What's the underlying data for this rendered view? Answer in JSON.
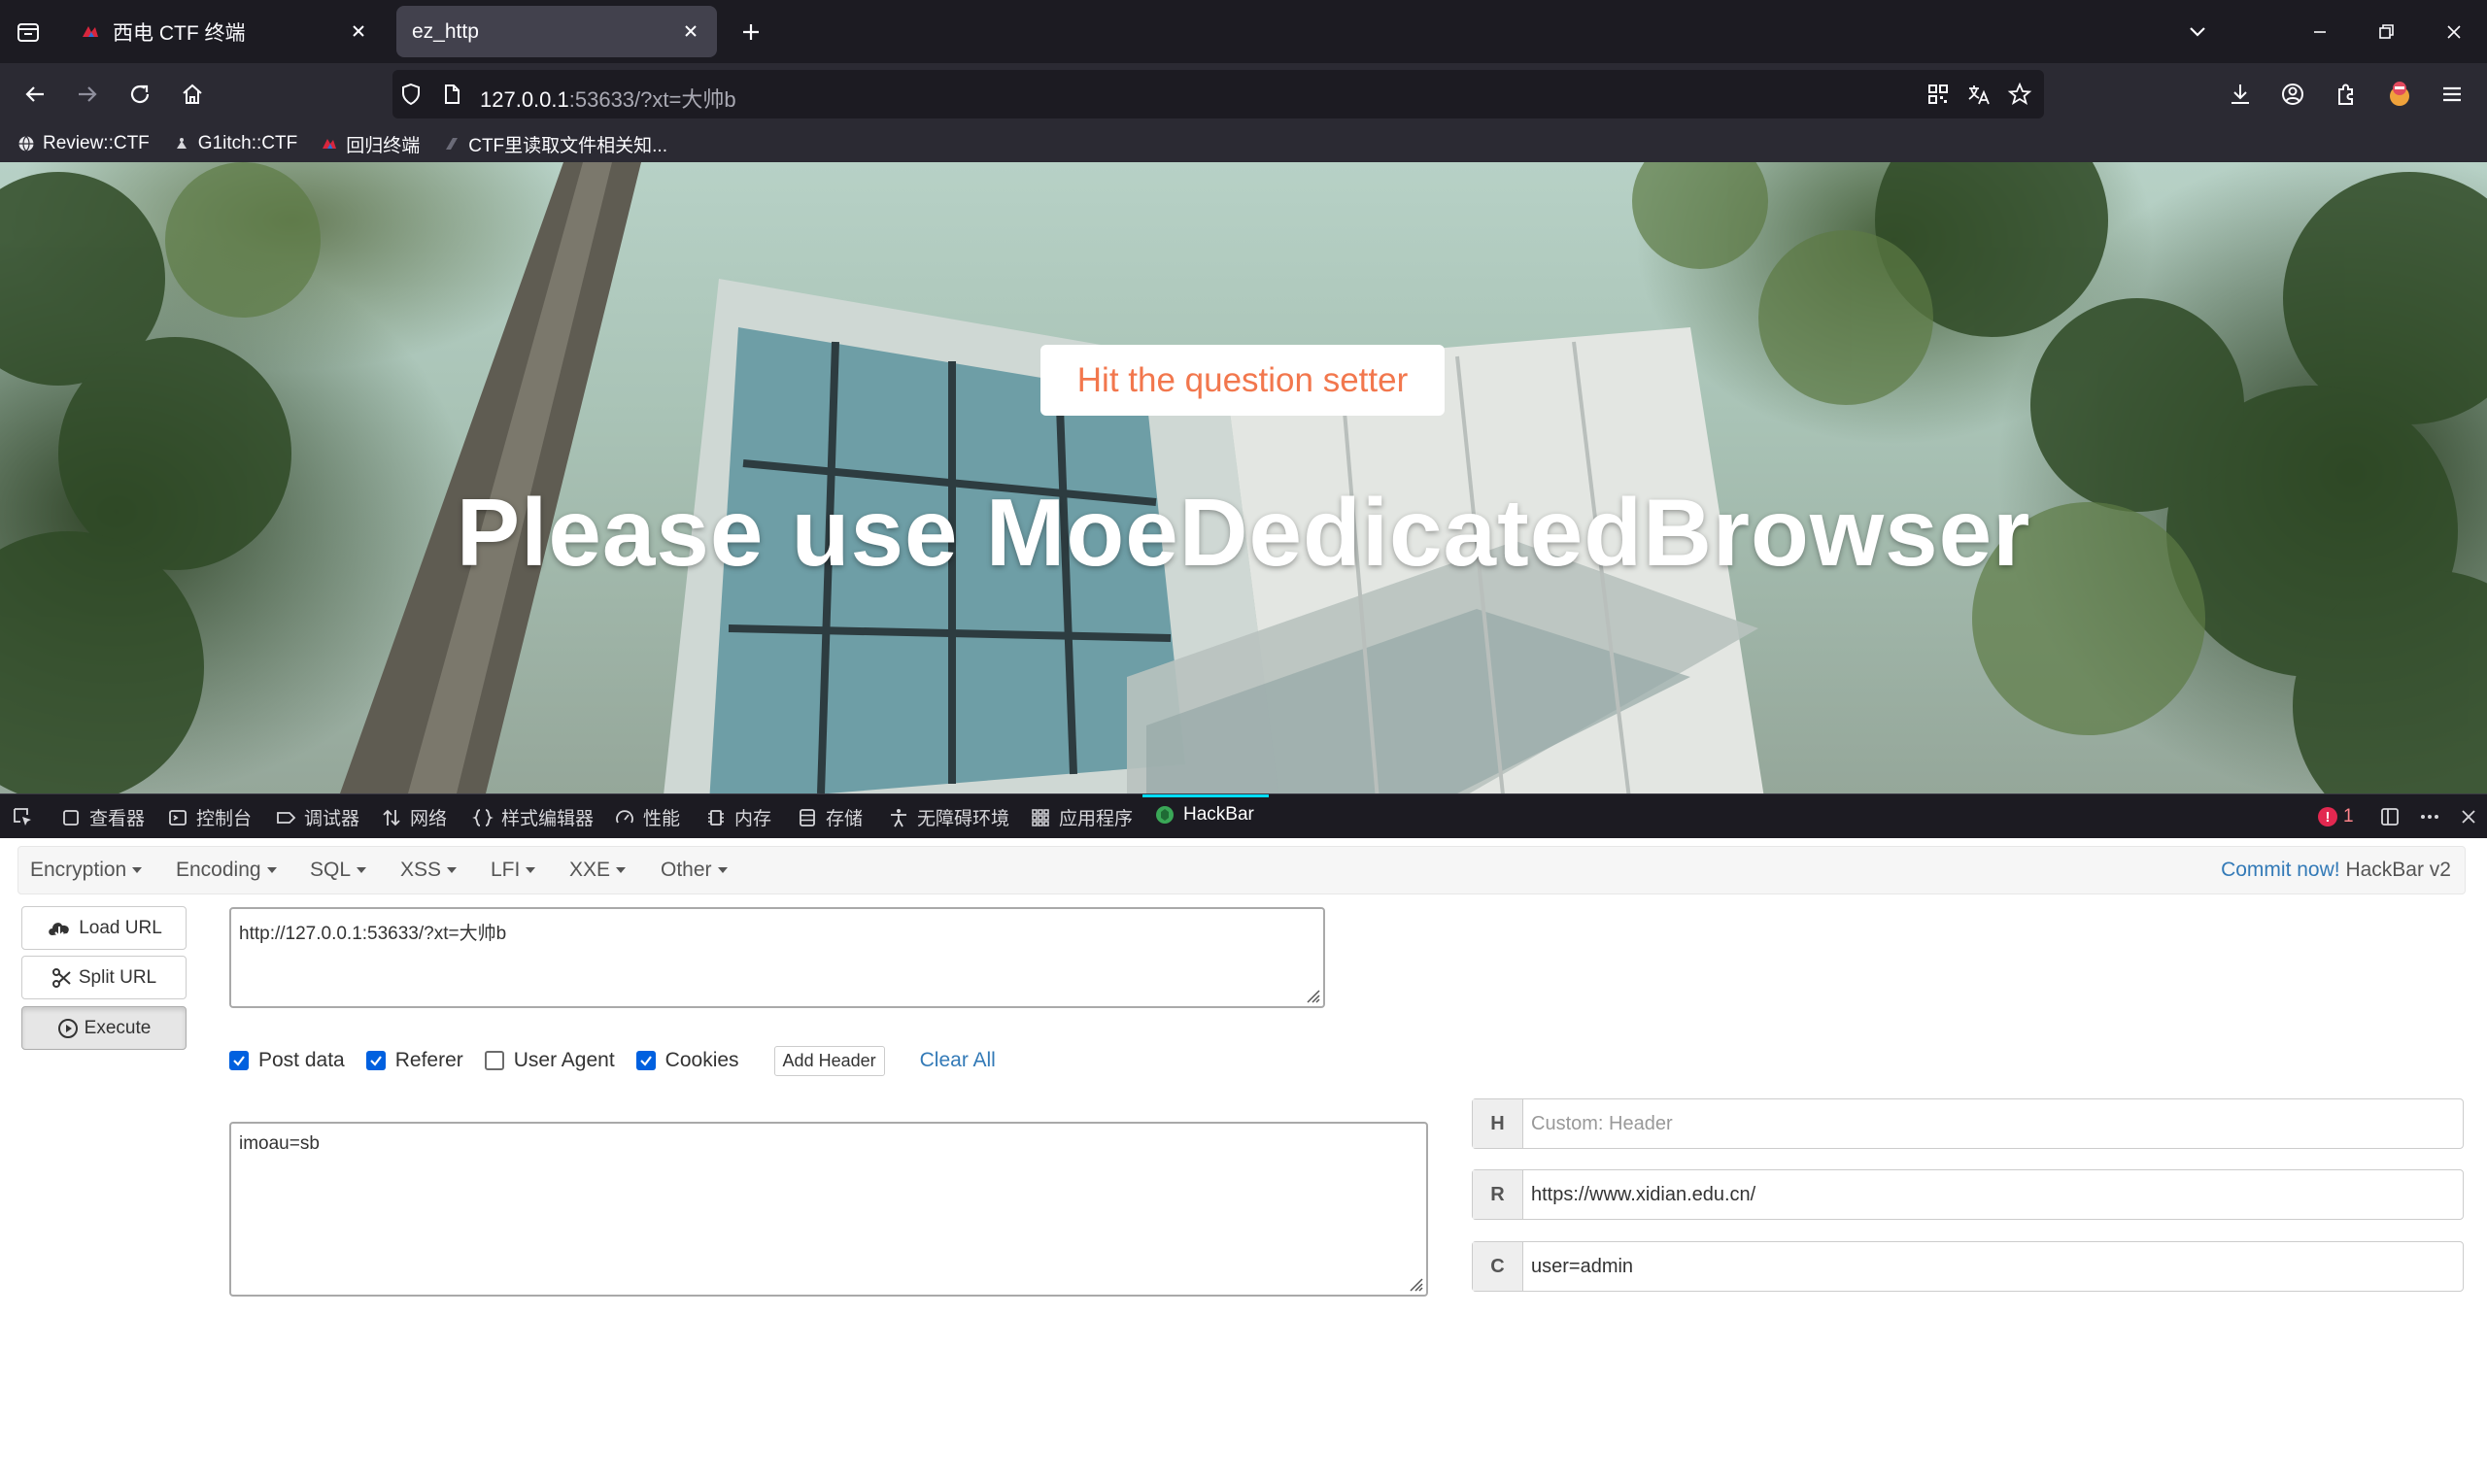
{
  "browser": {
    "tabs": [
      {
        "title": "西电 CTF 终端",
        "active": false
      },
      {
        "title": "ez_http",
        "active": true
      }
    ],
    "url_host": "127.0.0.1",
    "url_rest": ":53633/?xt=大帅b",
    "bookmarks": [
      {
        "label": "Review::CTF"
      },
      {
        "label": "G1itch::CTF"
      },
      {
        "label": "回归终端"
      },
      {
        "label": "CTF里读取文件相关知..."
      }
    ]
  },
  "page": {
    "prompt_button": "Hit the question setter",
    "message": "Please use MoeDedicatedBrowser",
    "prompt_color": "#f2774d"
  },
  "devtools": {
    "tabs": [
      {
        "label": "查看器",
        "icon": "inspector-icon"
      },
      {
        "label": "控制台",
        "icon": "console-icon"
      },
      {
        "label": "调试器",
        "icon": "debugger-icon"
      },
      {
        "label": "网络",
        "icon": "network-icon"
      },
      {
        "label": "样式编辑器",
        "icon": "style-editor-icon"
      },
      {
        "label": "性能",
        "icon": "performance-icon"
      },
      {
        "label": "内存",
        "icon": "memory-icon"
      },
      {
        "label": "存储",
        "icon": "storage-icon"
      },
      {
        "label": "无障碍环境",
        "icon": "accessibility-icon"
      },
      {
        "label": "应用程序",
        "icon": "application-icon"
      },
      {
        "label": "HackBar",
        "icon": "hackbar-icon"
      }
    ],
    "error_count": "1"
  },
  "hackbar": {
    "menus": [
      {
        "label": "Encryption"
      },
      {
        "label": "Encoding"
      },
      {
        "label": "SQL"
      },
      {
        "label": "XSS"
      },
      {
        "label": "LFI"
      },
      {
        "label": "XXE"
      },
      {
        "label": "Other"
      }
    ],
    "commit_link": "Commit now!",
    "version": "HackBar v2",
    "buttons": {
      "load_url": "Load URL",
      "split_url": "Split URL",
      "execute": "Execute"
    },
    "url_value": "http://127.0.0.1:53633/?xt=大帅b",
    "options": {
      "post_data": {
        "label": "Post data",
        "checked": true
      },
      "referer": {
        "label": "Referer",
        "checked": true
      },
      "user_agent": {
        "label": "User Agent",
        "checked": false
      },
      "cookies": {
        "label": "Cookies",
        "checked": true
      }
    },
    "add_header": "Add Header",
    "clear_all": "Clear All",
    "post_body": "imoau=sb",
    "headers": [
      {
        "key": "H",
        "value": "",
        "placeholder": "Custom: Header"
      },
      {
        "key": "R",
        "value": "https://www.xidian.edu.cn/",
        "placeholder": ""
      },
      {
        "key": "C",
        "value": "user=admin",
        "placeholder": ""
      }
    ]
  }
}
